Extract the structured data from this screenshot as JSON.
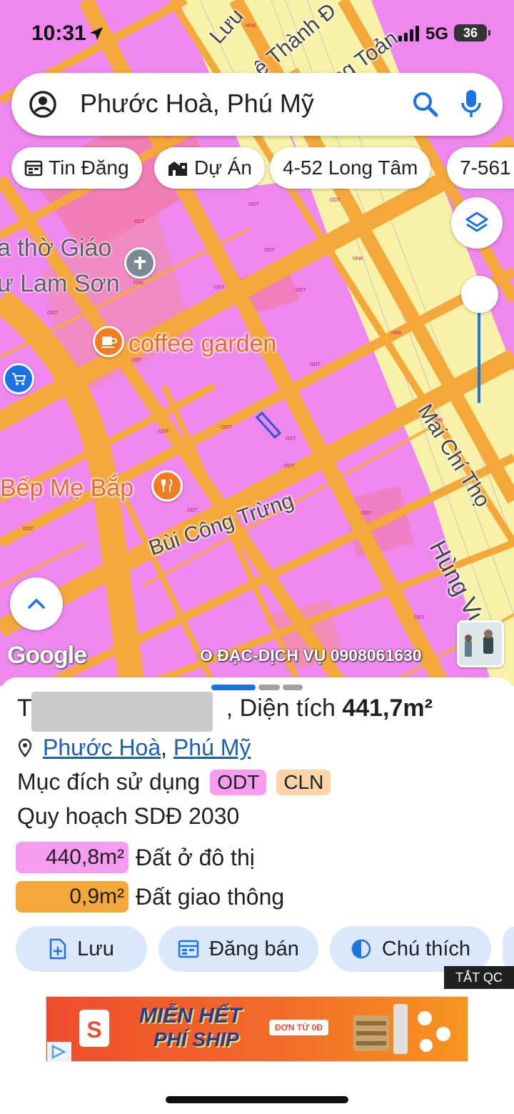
{
  "status_bar": {
    "time": "10:31",
    "network": "5G",
    "battery": "36"
  },
  "search": {
    "query": "Phước Hoà, Phú Mỹ"
  },
  "chips": [
    {
      "label": "Tin Đăng",
      "icon": "calendar-icon"
    },
    {
      "label": "Dự Án",
      "icon": "buildings-icon"
    },
    {
      "label": "4-52 Long Tâm",
      "icon": ""
    },
    {
      "label": "7-561",
      "icon": ""
    }
  ],
  "map": {
    "pois": {
      "church_line1": "a thờ Giáo",
      "church_line2": "ư Lam Sơn",
      "cafe": "coffee garden",
      "restaurant": "Bếp Mẹ Bắp"
    },
    "streets": {
      "top_left": "Lưu",
      "top_le": "ê Thành Đ",
      "top_toan": "ng Toản",
      "mai_chi_tho": "Mai Chí Thọ",
      "hung_vuong": "Hùng Vươn",
      "bui_cong_trung": "Bùi Công Trừng"
    },
    "codes": [
      "ODT",
      "HNK",
      "TON"
    ],
    "google_logo": "Google",
    "watermark": "O ĐẠC-DỊCH VỤ 0908061630"
  },
  "sheet": {
    "title_prefix": "T",
    "title_suffix": ", Diện tích",
    "area_value": "441,7m²",
    "location": {
      "ward": "Phước Hoà",
      "sep": ", ",
      "town": "Phú Mỹ"
    },
    "purpose_label": "Mục đích sử dụng",
    "purpose_tags": [
      "ODT",
      "CLN"
    ],
    "plan_label": "Quy hoạch SDĐ 2030",
    "plan_rows": [
      {
        "amount": "440,8m²",
        "desc": "Đất ở đô thị",
        "color": "#f59cf0"
      },
      {
        "amount": "0,9m²",
        "desc": "Đất giao thông",
        "color": "#f5a83a"
      }
    ],
    "actions": {
      "save": "Lưu",
      "post": "Đăng bán",
      "legend": "Chú thích"
    }
  },
  "ad": {
    "close_label": "TẮT QC",
    "headline1": "MIỄN HẾT",
    "headline2": "PHÍ SHIP",
    "badge": "ĐƠN TỪ 0Đ",
    "logo": "S"
  },
  "colors": {
    "urban_land": "#ee88ee",
    "road": "#f5a83a",
    "rice_land": "#f7f2a8",
    "accent": "#1a73e8"
  }
}
